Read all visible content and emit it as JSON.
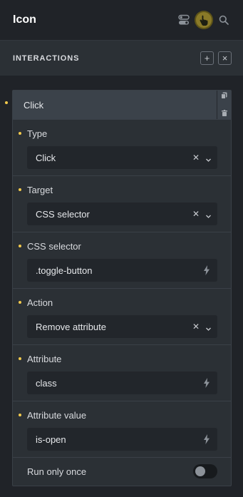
{
  "header": {
    "title": "Icon",
    "icons": [
      "toggle-icon",
      "pointer-icon",
      "search-icon"
    ]
  },
  "section": {
    "title": "INTERACTIONS",
    "add_label": "+",
    "close_label": "×"
  },
  "interaction": {
    "title": "Click",
    "fields": {
      "type": {
        "label": "Type",
        "value": "Click"
      },
      "target": {
        "label": "Target",
        "value": "CSS selector"
      },
      "css_selector": {
        "label": "CSS selector",
        "value": ".toggle-button"
      },
      "action": {
        "label": "Action",
        "value": "Remove attribute"
      },
      "attribute": {
        "label": "Attribute",
        "value": "class"
      },
      "attribute_value": {
        "label": "Attribute value",
        "value": "is-open"
      }
    },
    "run_only_once": {
      "label": "Run only once",
      "on": false
    }
  },
  "colors": {
    "accent_dot": "#f2c94c",
    "active_icon": "#8a7a28",
    "background": "#202328",
    "card": "#2b3035"
  }
}
